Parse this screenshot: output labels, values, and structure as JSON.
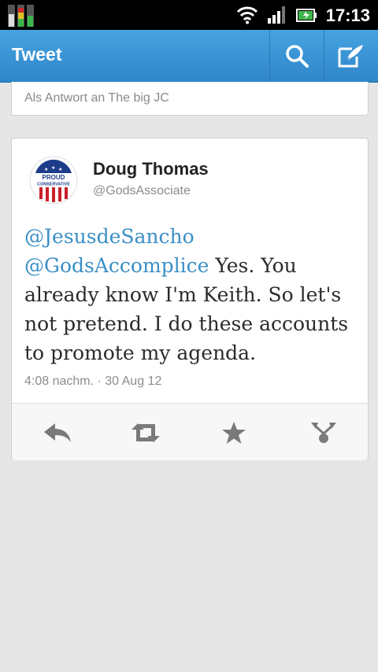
{
  "status_bar": {
    "time": "17:13"
  },
  "action_bar": {
    "title": "Tweet"
  },
  "reply_context": {
    "text": "Als Antwort an The big JC"
  },
  "tweet": {
    "author_name": "Doug Thomas",
    "author_handle": "@GodsAssociate",
    "avatar_text_line1": "PROUD",
    "avatar_text_line2": "CONSERVATIVE",
    "mention1": "@JesusdeSancho",
    "mention2": "@GodsAccomplice",
    "body": " Yes. You already know I'm Keith. So let's not pretend. I do these accounts to promote my agenda.",
    "meta": "4:08 nachm. · 30 Aug 12"
  },
  "colors": {
    "action_bar": "#3796d6",
    "mention": "#3a8fc6",
    "background": "#e6e6e6"
  }
}
